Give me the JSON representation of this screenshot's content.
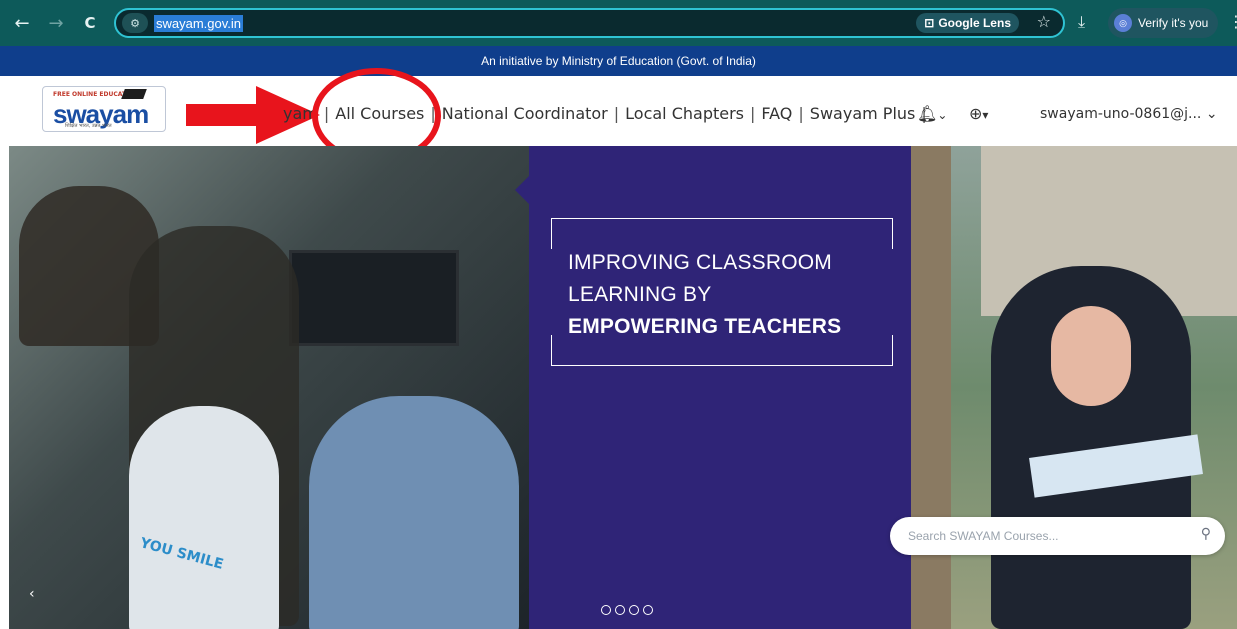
{
  "browser": {
    "url": "swayam.gov.in",
    "lens_label": "Google Lens",
    "verify_label": "Verify it's you",
    "nav_back": "←",
    "nav_forward": "→",
    "nav_reload": "C",
    "icons": [
      "back-icon",
      "forward-icon",
      "reload-icon",
      "site-info-icon",
      "lens-icon",
      "star-icon",
      "download-icon",
      "avatar-icon",
      "kebab-menu-icon"
    ]
  },
  "banner": {
    "initiative": "An initiative by Ministry of Education (Govt. of India)"
  },
  "header": {
    "logo": {
      "tag": "FREE ONLINE EDUCATION",
      "word": "swayam",
      "sub": "शिक्षित भारत, उन्नत भारत"
    },
    "nav_links": [
      "yam",
      "All Courses",
      "National Coordinator",
      "Local Chapters",
      "FAQ",
      "Swayam Plus"
    ],
    "separator": "|",
    "user": "swayam-uno-0861@j...",
    "bell_caret": "⌄",
    "globe_caret": "▾",
    "annotation_color": "#e8141c"
  },
  "hero": {
    "line1": "IMPROVING CLASSROOM",
    "line2": "LEARNING BY",
    "line3": "EMPOWERING TEACHERS",
    "accent": "#2f2477",
    "slide_count": 4,
    "tshirt_text": "YOU SMILE"
  },
  "search": {
    "placeholder": "Search SWAYAM Courses..."
  }
}
